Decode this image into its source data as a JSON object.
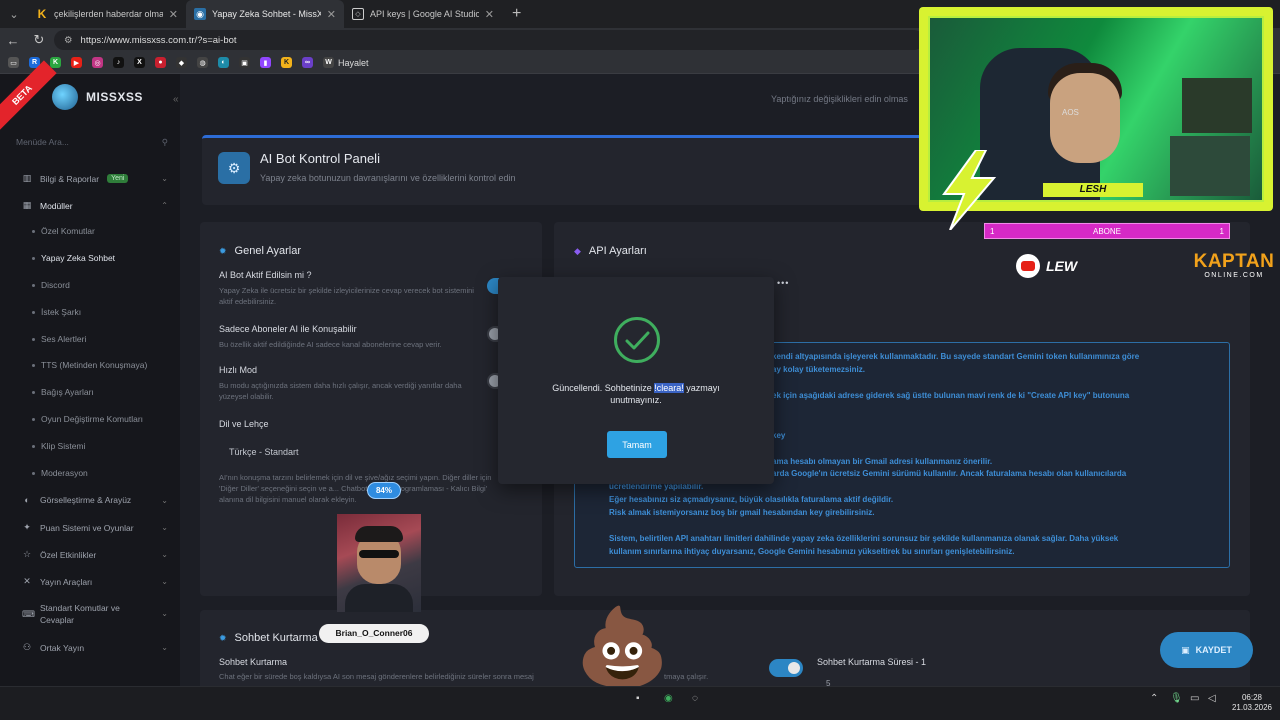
{
  "browser": {
    "tabs": [
      {
        "label": "çekilişlerden haberdar olmak için",
        "favicon": "K",
        "active": false
      },
      {
        "label": "Yapay Zeka Sohbet - MissXss AI Bo",
        "favicon": "ai-bot-icon",
        "active": true
      },
      {
        "label": "API keys | Google AI Studio",
        "favicon": "google-ai-icon",
        "active": false
      }
    ],
    "url": "https://www.missxss.com.tr/?s=ai-bot",
    "bookmark_label": "Hayalet"
  },
  "sidebar": {
    "beta": "BETA",
    "logo": "MISSXSS",
    "search_placeholder": "Menüde Ara...",
    "items": [
      {
        "label": "Bilgi & Raporlar",
        "badge": "Yeni"
      },
      {
        "label": "Modüller"
      },
      {
        "label": "Görselleştirme & Arayüz"
      },
      {
        "label": "Puan Sistemi ve Oyunlar"
      },
      {
        "label": "Özel Etkinlikler"
      },
      {
        "label": "Yayın Araçları"
      },
      {
        "label": "Standart Komutlar ve Cevaplar"
      },
      {
        "label": "Ortak Yayın"
      }
    ],
    "subitems": [
      "Özel Komutlar",
      "Yapay Zeka Sohbet",
      "Discord",
      "İstek Şarkı",
      "Ses Alertleri",
      "TTS (Metinden Konuşmaya)",
      "Bağış Ayarları",
      "Oyun Değiştirme Komutları",
      "Klip Sistemi",
      "Moderasyon"
    ]
  },
  "main": {
    "top_notice": "Yaptığınız değişiklikleri edin olmas",
    "header": {
      "title": "AI Bot Kontrol Paneli",
      "subtitle": "Yapay zeka botunuzun davranışlarını ve özelliklerini kontrol edin"
    },
    "general": {
      "title": "Genel Ayarlar",
      "bot_active_label": "AI Bot Aktif Edilsin mi ?",
      "bot_active_desc": "Yapay Zeka ile ücretsiz bir şekilde izleyicilerinize cevap verecek bot sistemini aktif edebilirsiniz.",
      "subs_only_label": "Sadece Aboneler AI ile Konuşabilir",
      "subs_only_desc": "Bu özellik aktif edildiğinde AI sadece kanal abonelerine cevap verir.",
      "fast_mode_label": "Hızlı Mod",
      "fast_mode_desc": "Bu modu açtığınızda sistem daha hızlı çalışır, ancak verdiği yanıtlar daha yüzeysel olabilir.",
      "lang_label": "Dil ve Lehçe",
      "lang_value": "Türkçe - Standart",
      "lang_desc": "AI'nın konuşma tarzını belirlemek için dil ve şive/ağız seçimi yapın. Diğer diller için 'Diğer Diller' seçeneğini seçin ve a... Chatbot Cevap Programlaması - Kalıcı Bilgi' alanına dil bilgisini manuel olarak ekleyin."
    },
    "api": {
      "title": "API Ayarları",
      "masked": "•••",
      "lines": [
        "kendi altyapısında işleyerek kullanmaktadır. Bu sayede standart Gemini token kullanımınıza göre",
        "ay kolay tüketemezsiniz.",
        "ek için aşağıdaki adrese giderek sağ üstte bulunan mavi renk de ki \"Create API key\" butonuna",
        "key",
        "ama hesabı olmayan bir Gmail adresi kullanmanız önerilir.",
        "arda Google'ın ücretsiz Gemini sürümü kullanılır. Ancak faturalama hesabı olan kullanıcılarda",
        "ücretlendirme yapılabilir.",
        "Eğer hesabınızı siz açmadıysanız, büyük olasılıkla faturalama aktif değildir.",
        "Risk almak istemiyorsanız boş bir gmail hesabından key girebilirsiniz.",
        "Sistem, belirtilen API anahtarı limitleri dahilinde yapay zeka özelliklerini sorunsuz bir şekilde kullanmanıza olanak sağlar. Daha yüksek",
        "kullanım sınırlarına ihtiyaç duyarsanız, Google Gemini hesabınızı yükseltirek bu sınırları genişletebilirsiniz."
      ]
    },
    "recovery": {
      "title": "Sohbet Kurtarma",
      "label": "Sohbet Kurtarma",
      "desc": "Chat eğer bir sürede boş kaldıysa AI son mesaj gönderenlere belirlediğiniz süreler sonra mesaj",
      "desc2": "tmaya çalışır.",
      "duration_label": "Sohbet Kurtarma Süresi - 1",
      "duration_value": "5"
    },
    "save_label": "KAYDET"
  },
  "modal": {
    "text_before": "Güncellendi. Sohbetinize ",
    "text_highlight": "!cleara!",
    "text_after": " yazmayı unutmayınız.",
    "ok_label": "Tamam"
  },
  "overlay": {
    "streamer_name": "LESH",
    "abone_label": "ABONE",
    "abone_left": "1",
    "abone_right": "1",
    "youtube_name": "LEW",
    "kaptan_line1": "KAPTAN",
    "kaptan_line2": "ONLINE.COM",
    "cam_text": "AOS",
    "profile_percent": "84%",
    "profile_name": "Brian_O_Conner06"
  },
  "taskbar": {
    "time": "06:28",
    "date": "21.03.2026"
  },
  "colors": {
    "accent": "#2ea2e3",
    "success": "#3fae5e",
    "overlay_yellow": "#d8f231",
    "abone_pink": "#d629c6"
  }
}
